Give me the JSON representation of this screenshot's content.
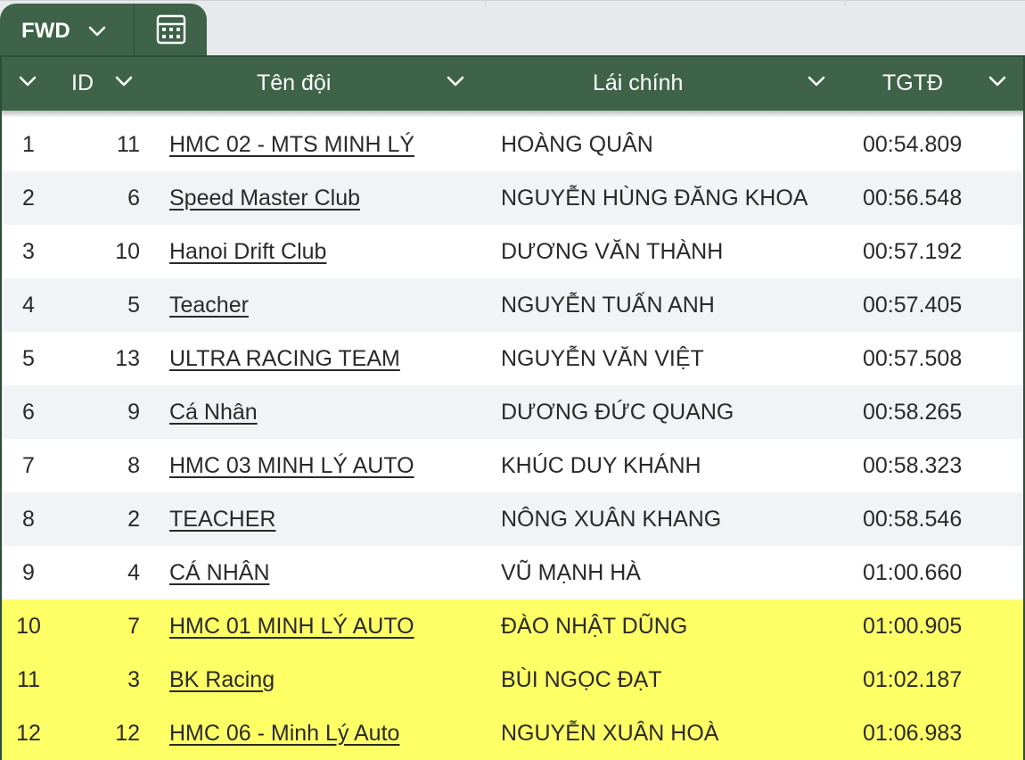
{
  "view_tab": {
    "label": "FWD"
  },
  "colors": {
    "header_bg": "#3e6349",
    "row_alt": "#f1f3f6",
    "highlight": "#ffff66"
  },
  "columns": {
    "id": "ID",
    "team": "Tên đội",
    "driver": "Lái chính",
    "time": "TGTĐ"
  },
  "rows": [
    {
      "rank": "1",
      "id": "11",
      "team": "HMC 02 - MTS MINH LÝ",
      "driver": "HOÀNG QUÂN",
      "time": "00:54.809",
      "highlighted": false
    },
    {
      "rank": "2",
      "id": "6",
      "team": "Speed Master Club",
      "driver": "NGUYỄN HÙNG ĐĂNG KHOA",
      "time": "00:56.548",
      "highlighted": false
    },
    {
      "rank": "3",
      "id": "10",
      "team": "Hanoi Drift Club",
      "driver": "DƯƠNG VĂN THÀNH",
      "time": "00:57.192",
      "highlighted": false
    },
    {
      "rank": "4",
      "id": "5",
      "team": "Teacher",
      "driver": "NGUYỄN TUẤN ANH",
      "time": "00:57.405",
      "highlighted": false
    },
    {
      "rank": "5",
      "id": "13",
      "team": "ULTRA RACING TEAM",
      "driver": "NGUYỄN VĂN VIỆT",
      "time": "00:57.508",
      "highlighted": false
    },
    {
      "rank": "6",
      "id": "9",
      "team": "Cá Nhân",
      "driver": "DƯƠNG ĐỨC QUANG",
      "time": "00:58.265",
      "highlighted": false
    },
    {
      "rank": "7",
      "id": "8",
      "team": "HMC 03 MINH LÝ AUTO",
      "driver": "KHÚC DUY KHÁNH",
      "time": "00:58.323",
      "highlighted": false
    },
    {
      "rank": "8",
      "id": "2",
      "team": "TEACHER",
      "driver": "NÔNG XUÂN KHANG",
      "time": "00:58.546",
      "highlighted": false
    },
    {
      "rank": "9",
      "id": "4",
      "team": "CÁ NHÂN",
      "driver": "VŨ MẠNH HÀ",
      "time": "01:00.660",
      "highlighted": false
    },
    {
      "rank": "10",
      "id": "7",
      "team": "HMC 01 MINH LÝ AUTO",
      "driver": "ĐÀO NHẬT DŨNG",
      "time": "01:00.905",
      "highlighted": true
    },
    {
      "rank": "11",
      "id": "3",
      "team": "BK Racing",
      "driver": "BÙI NGỌC ĐẠT",
      "time": "01:02.187",
      "highlighted": true
    },
    {
      "rank": "12",
      "id": "12",
      "team": "HMC 06 - Minh Lý Auto",
      "driver": "NGUYỄN XUÂN HOÀ",
      "time": "01:06.983",
      "highlighted": true
    }
  ]
}
